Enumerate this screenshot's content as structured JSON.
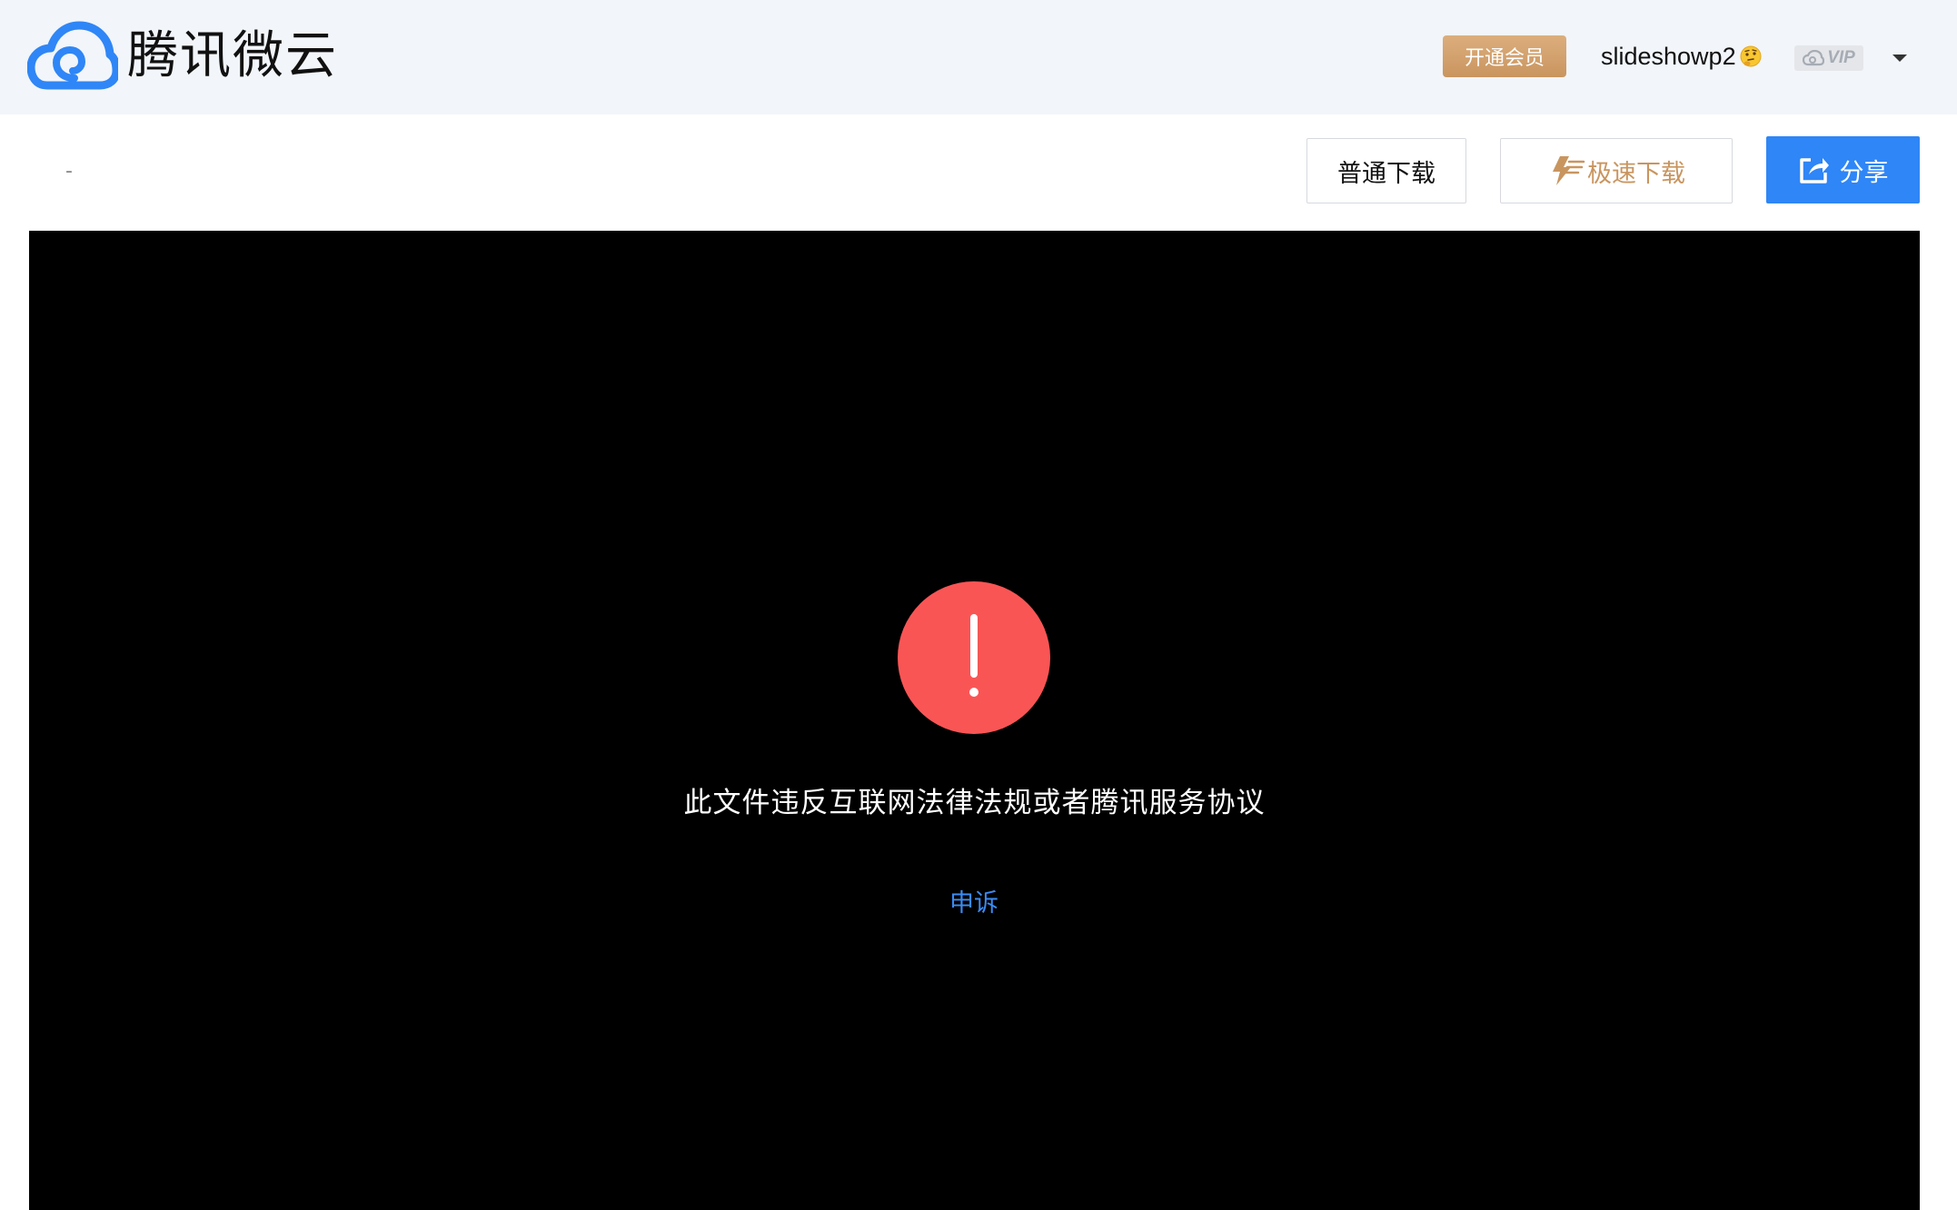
{
  "header": {
    "brand_name": "腾讯微云",
    "vip_open_label": "开通会员",
    "username": "slideshowp2",
    "vip_badge_label": "VIP",
    "icons": [
      "weiyun-cloud-logo-icon",
      "thinking-face-emoji-icon",
      "vip-cloud-icon",
      "caret-down-icon"
    ]
  },
  "toolbar": {
    "file_name": "-",
    "normal_download_label": "普通下载",
    "fast_download_label": "极速下载",
    "share_label": "分享",
    "icons": [
      "lightning-icon",
      "share-icon"
    ]
  },
  "viewer": {
    "alert_icon": "exclamation-alert-icon",
    "message": "此文件违反互联网法律法规或者腾讯服务协议",
    "appeal_label": "申诉"
  },
  "colors": {
    "header_bg": "#f2f5f9",
    "brand_blue": "#2f86f6",
    "gold": "#c9955f",
    "alert_red": "#fa5555",
    "viewer_bg": "#000000",
    "link_blue": "#3a8bf5"
  }
}
